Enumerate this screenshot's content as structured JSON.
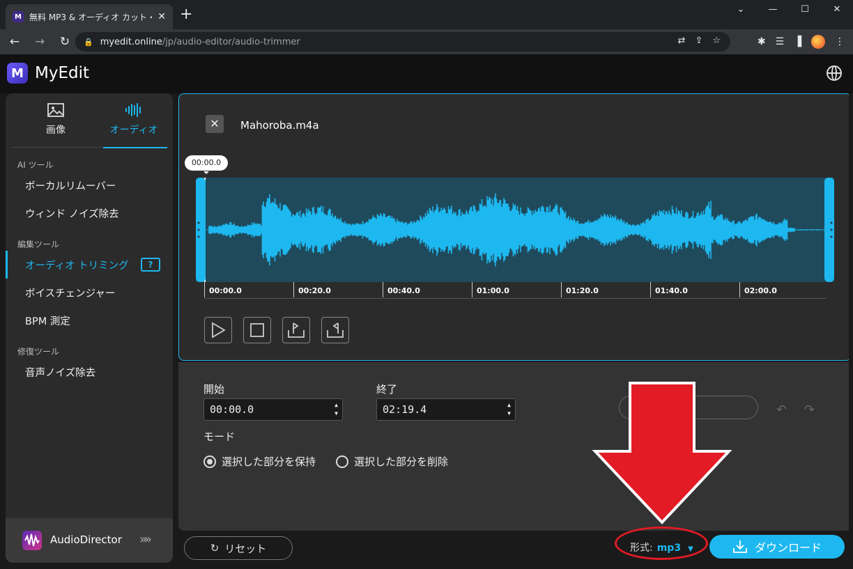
{
  "browser": {
    "tab_title": "無料 MP3 & オーディオ カット・トリミング",
    "tab_favicon": "M",
    "url_host": "myedit.online",
    "url_path": "/jp/audio-editor/audio-trimmer",
    "window_buttons": [
      "⌄",
      "—",
      "☐",
      "✕"
    ]
  },
  "app": {
    "logo_letter": "M",
    "brand": "MyEdit"
  },
  "sidebar": {
    "mode_tabs": [
      {
        "label": "画像",
        "icon": "image-icon"
      },
      {
        "label": "オーディオ",
        "icon": "audio-wave-icon"
      }
    ],
    "sections": [
      {
        "title": "AI ツール",
        "items": [
          "ボーカルリムーバー",
          "ウィンド ノイズ除去"
        ]
      },
      {
        "title": "編集ツール",
        "items": [
          "オーディオ トリミング",
          "ボイスチェンジャー",
          "BPM 測定"
        ]
      },
      {
        "title": "修復ツール",
        "items": [
          "音声ノイズ除去"
        ]
      }
    ],
    "active_item": "オーディオ トリミング",
    "help_icon_text": "?",
    "promo": {
      "name": "AudioDirector",
      "arrow": "»»"
    }
  },
  "editor": {
    "file_name": "Mahoroba.m4a",
    "playhead_time": "00:00.0",
    "timeline_ticks": [
      "00:00.0",
      "00:20.0",
      "00:40.0",
      "01:00.0",
      "01:20.0",
      "01:40.0",
      "02:00.0"
    ],
    "wave_color": "#1eb8f0",
    "controls": [
      "play-icon",
      "stop-icon",
      "set-start-icon",
      "set-end-icon"
    ]
  },
  "settings": {
    "start_label": "開始",
    "start_value": "00:00.0",
    "end_label": "終了",
    "end_value": "02:19.4",
    "apply_label": "用",
    "mode_label": "モード",
    "mode_options": [
      "選択した部分を保持",
      "選択した部分を削除"
    ],
    "mode_selected": 0
  },
  "footer": {
    "reset_label": "リセット",
    "format_label": "形式:",
    "format_value": "mp3",
    "download_label": "ダウンロード"
  },
  "annotation_color": "#e21b25"
}
